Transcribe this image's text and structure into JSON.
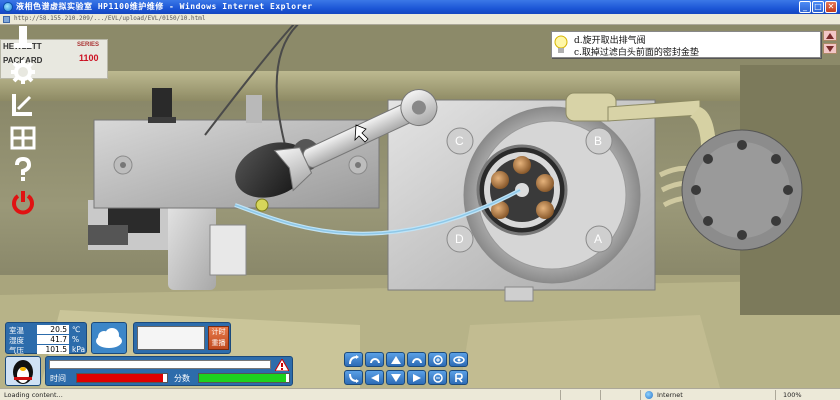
{
  "window": {
    "title": "液相色谱虚拟实验室 HP1100维护维修 - Windows Internet Explorer",
    "url": "http://58.155.210.209/.../EVL/upload/EVL/0150/10.html"
  },
  "instrument_plate": {
    "brand_line1": "HEWLETT",
    "brand_line2": "PACKARD",
    "series": "SERIES",
    "model": "1100"
  },
  "tools": [
    {
      "name": "wrench-tool",
      "icon": "wrench-icon"
    },
    {
      "name": "settings-tool",
      "icon": "gear-icon"
    },
    {
      "name": "move-tool",
      "icon": "corner-arrow-icon"
    },
    {
      "name": "grid-tool",
      "icon": "grid-icon"
    },
    {
      "name": "help-tool",
      "icon": "question-icon"
    },
    {
      "name": "power-tool",
      "icon": "power-icon"
    }
  ],
  "instructions": {
    "line1": "d.旋开取出排气阀",
    "line2": "c.取掉过滤白头前面的密封金垫"
  },
  "valve_labels": [
    "C",
    "B",
    "D",
    "A"
  ],
  "environment": {
    "temp_label": "室温",
    "temp_value": "20.5",
    "temp_unit": "℃",
    "humidity_label": "湿度",
    "humidity_value": "41.7",
    "humidity_unit": "%",
    "pressure_label": "气压",
    "pressure_value": "101.5",
    "pressure_unit": "kPa"
  },
  "timer": {
    "button_line1": "计时",
    "button_line2": "重播"
  },
  "status": {
    "time_label": "时间",
    "score_label": "分数",
    "time_progress": 0.96,
    "score_progress": 0.97
  },
  "colors": {
    "hud_blue": "#2d6cab",
    "time_bar": "#e00000",
    "score_bar": "#1ed21e"
  },
  "statusbar": {
    "loading": "Loading content...",
    "zone": "Internet",
    "zoom": "100%"
  }
}
